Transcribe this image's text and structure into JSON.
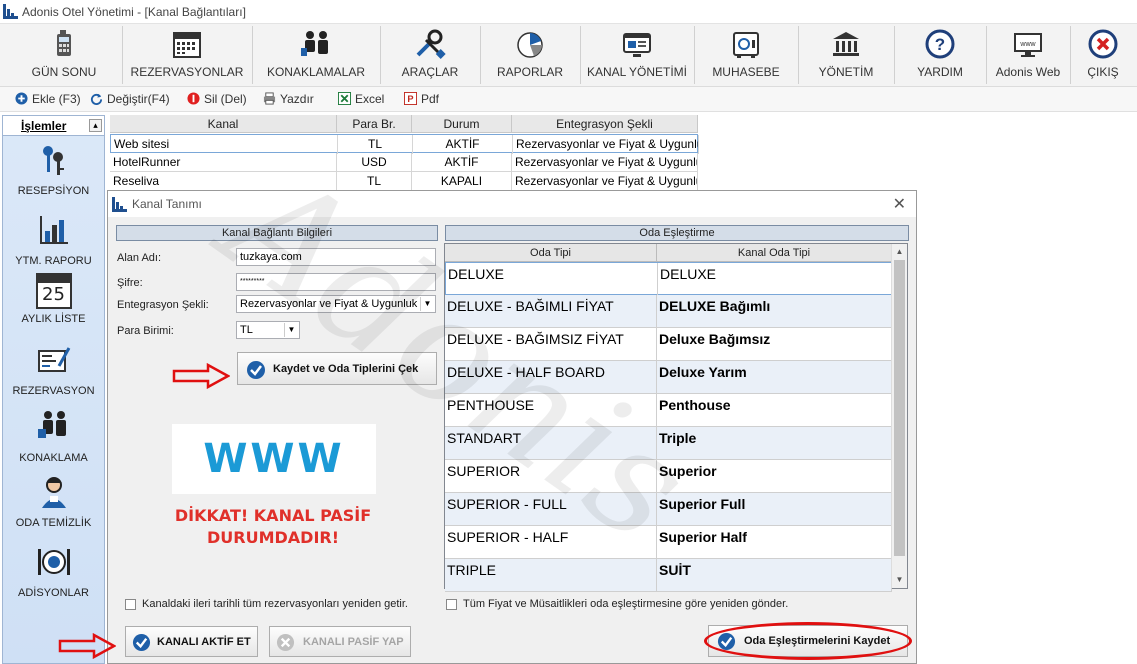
{
  "window": {
    "title": "Adonis Otel Yönetimi - [Kanal Bağlantıları]"
  },
  "ribbon": [
    {
      "label": "GÜN SONU",
      "icon": "calculator-icon"
    },
    {
      "label": "REZERVASYONLAR",
      "icon": "calendar-icon"
    },
    {
      "label": "KONAKLAMALAR",
      "icon": "guests-icon"
    },
    {
      "label": "ARAÇLAR",
      "icon": "tools-icon"
    },
    {
      "label": "RAPORLAR",
      "icon": "pie-chart-icon"
    },
    {
      "label": "KANAL YÖNETİMİ",
      "icon": "web-window-icon"
    },
    {
      "label": "MUHASEBE",
      "icon": "safe-icon"
    },
    {
      "label": "YÖNETİM",
      "icon": "bank-icon"
    },
    {
      "label": "YARDIM",
      "icon": "help-icon"
    },
    {
      "label": "Adonis Web",
      "icon": "www-monitor-icon"
    },
    {
      "label": "ÇIKIŞ",
      "icon": "exit-icon"
    }
  ],
  "toolbar": {
    "add": "Ekle (F3)",
    "edit": "Değiştir(F4)",
    "delete": "Sil (Del)",
    "print": "Yazdır",
    "excel": "Excel",
    "pdf": "Pdf"
  },
  "sidebar": {
    "header": "İşlemler",
    "items": [
      {
        "label": "RESEPSİYON",
        "icon": "keys-icon"
      },
      {
        "label": "YTM. RAPORU",
        "icon": "bar-chart-icon"
      },
      {
        "label": "AYLIK LİSTE",
        "icon": "calendar-25-icon",
        "day": "25"
      },
      {
        "label": "REZERVASYON",
        "icon": "form-pen-icon"
      },
      {
        "label": "KONAKLAMA",
        "icon": "guests-icon"
      },
      {
        "label": "ODA TEMİZLİK",
        "icon": "housekeeper-icon"
      },
      {
        "label": "ADİSYONLAR",
        "icon": "plate-cutlery-icon"
      }
    ]
  },
  "channels_table": {
    "columns": [
      "Kanal",
      "Para Br.",
      "Durum",
      "Entegrasyon Şekli"
    ],
    "rows": [
      [
        "Web sitesi",
        "TL",
        "AKTİF",
        "Rezervasyonlar ve Fiyat & Uygunluk"
      ],
      [
        "HotelRunner",
        "USD",
        "AKTİF",
        "Rezervasyonlar ve Fiyat & Uygunluk"
      ],
      [
        "Reseliva",
        "TL",
        "KAPALI",
        "Rezervasyonlar ve Fiyat & Uygunluk"
      ]
    ]
  },
  "dialog": {
    "title": "Kanal Tanımı",
    "left_section_title": "Kanal Bağlantı Bilgileri",
    "fields": {
      "domain_label": "Alan Adı:",
      "domain_value": "tuzkaya.com",
      "password_label": "Şifre:",
      "password_value": "*********",
      "integration_label": "Entegrasyon Şekli:",
      "integration_value": "Rezervasyonlar ve Fiyat & Uygunluk",
      "currency_label": "Para Birimi:",
      "currency_value": "TL"
    },
    "save_fetch_button": "Kaydet ve Oda Tiplerini Çek",
    "www_logo": "WWW",
    "warning": "DİKKAT! KANAL PASİF DURUMDADIR!",
    "refetch_reservations_checkbox": "Kanaldaki ileri tarihli tüm rezervasyonları yeniden getir.",
    "activate_button": "KANALI AKTİF ET",
    "deactivate_button": "KANALI PASİF YAP",
    "right_section_title": "Oda Eşleştirme",
    "mapping_columns": [
      "Oda Tipi",
      "Kanal Oda Tipi"
    ],
    "mapping_rows": [
      [
        "DELUXE",
        "DELUXE"
      ],
      [
        "DELUXE - BAĞIMLI FİYAT",
        "DELUXE Bağımlı"
      ],
      [
        "DELUXE - BAĞIMSIZ FİYAT",
        "Deluxe Bağımsız"
      ],
      [
        "DELUXE - HALF BOARD",
        "Deluxe Yarım"
      ],
      [
        "PENTHOUSE",
        "Penthouse"
      ],
      [
        "STANDART",
        "Triple"
      ],
      [
        "SUPERIOR",
        "Superior"
      ],
      [
        "SUPERIOR - FULL",
        "Superior Full"
      ],
      [
        "SUPERIOR - HALF",
        "Superior Half"
      ],
      [
        "TRIPLE",
        "SUİT"
      ]
    ],
    "resend_prices_checkbox": "Tüm Fiyat ve Müsaitlikleri oda eşleştirmesine göre yeniden gönder.",
    "save_mapping_button": "Oda Eşleştirmelerini Kaydet"
  },
  "watermark": "Adonis",
  "colors": {
    "accent_blue": "#1f5fa8",
    "warning_red": "#e0302a",
    "www_blue": "#1b9ad6",
    "annotation_red": "#e01010"
  }
}
